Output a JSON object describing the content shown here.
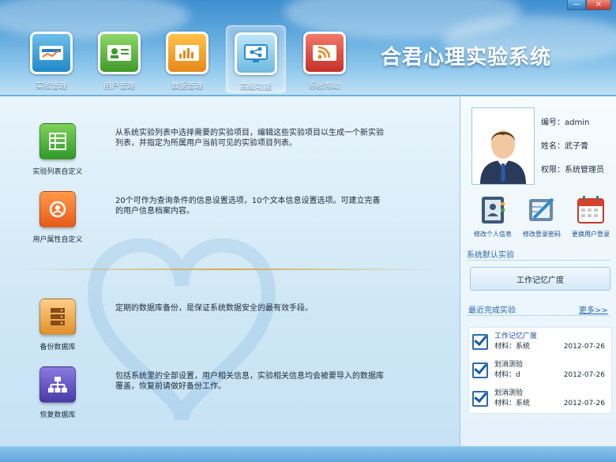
{
  "window": {
    "minimize": "—",
    "close": "×"
  },
  "app_title": "合君心理实验系统",
  "nav": [
    {
      "label": "实验管理",
      "icon": "experiment-icon",
      "active": false
    },
    {
      "label": "用户管理",
      "icon": "user-card-icon",
      "active": false
    },
    {
      "label": "数据管理",
      "icon": "data-chart-icon",
      "active": false
    },
    {
      "label": "高级功能",
      "icon": "advanced-monitor-icon",
      "active": true
    },
    {
      "label": "系统帮助",
      "icon": "help-rss-icon",
      "active": false
    }
  ],
  "features": [
    {
      "label": "实验列表自定义",
      "icon": "list-table-icon",
      "desc": "从系统实验列表中选择需要的实验项目，编辑这些实验项目以生成一个新实验列表，并指定为所属用户当前可见的实验项目列表。"
    },
    {
      "label": "用户属性自定义",
      "icon": "user-attr-icon",
      "desc": "20个可作为查询条件的信息设置选项，10个文本信息设置选项。可建立完善的用户信息档案内容。"
    },
    {
      "label": "备份数据库",
      "icon": "backup-db-icon",
      "desc": "定期的数据库备份，是保证系统数据安全的最有效手段。"
    },
    {
      "label": "恢复数据库",
      "icon": "restore-db-icon",
      "desc": "包括系统里的全部设置，用户相关信息，实验相关信息均会被要导入的数据库覆盖，恢复前请做好备份工作。"
    }
  ],
  "user": {
    "id_label": "编号：",
    "id": "admin",
    "name_label": "姓名：",
    "name": "武子膏",
    "role_label": "权限：",
    "role": "系统管理员"
  },
  "user_actions": [
    {
      "label": "修改个人信息",
      "icon": "address-book-icon"
    },
    {
      "label": "修改登录密码",
      "icon": "password-edit-icon"
    },
    {
      "label": "更换用户登录",
      "icon": "calendar-switch-icon"
    }
  ],
  "default_section": {
    "title": "系统默认实验",
    "button": "工作记忆广度"
  },
  "recent_section": {
    "title": "最近完成实验",
    "more": "更多>>"
  },
  "recent": [
    {
      "name": "工作记忆广度",
      "material": "材料：系统",
      "date": "2012-07-26",
      "highlight": true
    },
    {
      "name": "划消测验",
      "material": "材料：d",
      "date": "2012-07-26",
      "highlight": false
    },
    {
      "name": "划消测验",
      "material": "材料：系统",
      "date": "2012-07-26",
      "highlight": false
    }
  ]
}
